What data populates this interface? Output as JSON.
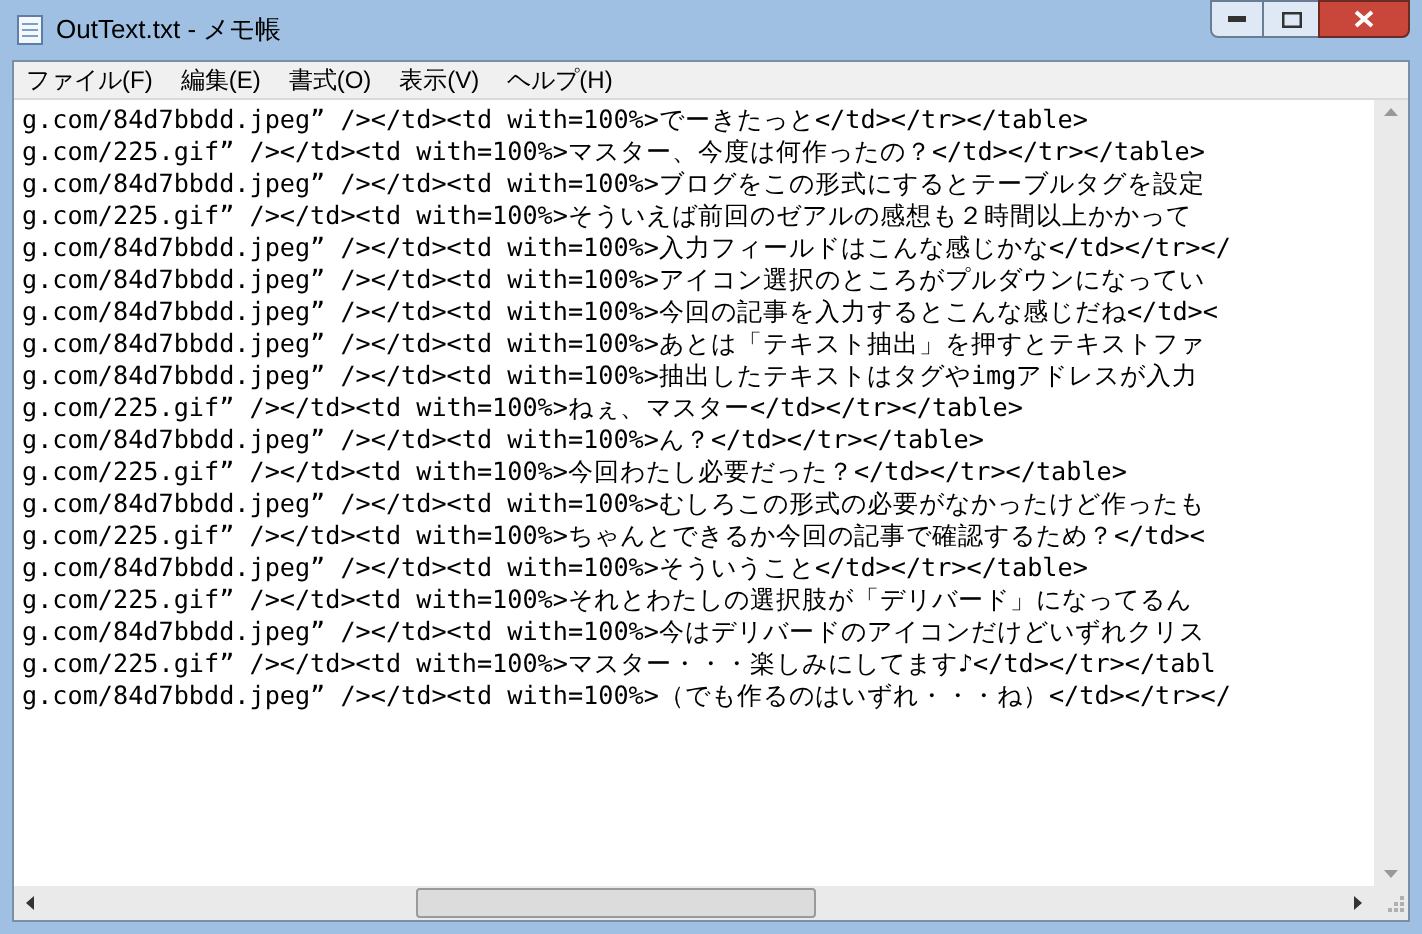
{
  "window": {
    "title": "OutText.txt - メモ帳"
  },
  "menu": [
    "ファイル(F)",
    "編集(E)",
    "書式(O)",
    "表示(V)",
    "ヘルプ(H)"
  ],
  "lines": [
    "g.com/84d7bbdd.jpeg” /></td><td with=100%>でーきたっと</td></tr></table>",
    "g.com/225.gif” /></td><td with=100%>マスター、今度は何作ったの？</td></tr></table>",
    "g.com/84d7bbdd.jpeg” /></td><td with=100%>ブログをこの形式にするとテーブルタグを設定",
    "g.com/225.gif” /></td><td with=100%>そういえば前回のゼアルの感想も２時間以上かかって",
    "g.com/84d7bbdd.jpeg” /></td><td with=100%>入力フィールドはこんな感じかな</td></tr></",
    "g.com/84d7bbdd.jpeg” /></td><td with=100%>アイコン選択のところがプルダウンになってい",
    "g.com/84d7bbdd.jpeg” /></td><td with=100%>今回の記事を入力するとこんな感じだね</td><",
    "g.com/84d7bbdd.jpeg” /></td><td with=100%>あとは「テキスト抽出」を押すとテキストファ",
    "g.com/84d7bbdd.jpeg” /></td><td with=100%>抽出したテキストはタグやimgアドレスが入力",
    "g.com/225.gif” /></td><td with=100%>ねぇ、マスター</td></tr></table>",
    "g.com/84d7bbdd.jpeg” /></td><td with=100%>ん？</td></tr></table>",
    "g.com/225.gif” /></td><td with=100%>今回わたし必要だった？</td></tr></table>",
    "g.com/84d7bbdd.jpeg” /></td><td with=100%>むしろこの形式の必要がなかったけど作ったも",
    "g.com/225.gif” /></td><td with=100%>ちゃんとできるか今回の記事で確認するため？</td><",
    "g.com/84d7bbdd.jpeg” /></td><td with=100%>そういうこと</td></tr></table>",
    "g.com/225.gif” /></td><td with=100%>それとわたしの選択肢が「デリバード」になってるん",
    "g.com/84d7bbdd.jpeg” /></td><td with=100%>今はデリバードのアイコンだけどいずれクリス",
    "g.com/225.gif” /></td><td with=100%>マスター・・・楽しみにしてます♪</td></tr></tabl",
    "g.com/84d7bbdd.jpeg” /></td><td with=100%>（でも作るのはいずれ・・・ね）</td></tr></"
  ]
}
